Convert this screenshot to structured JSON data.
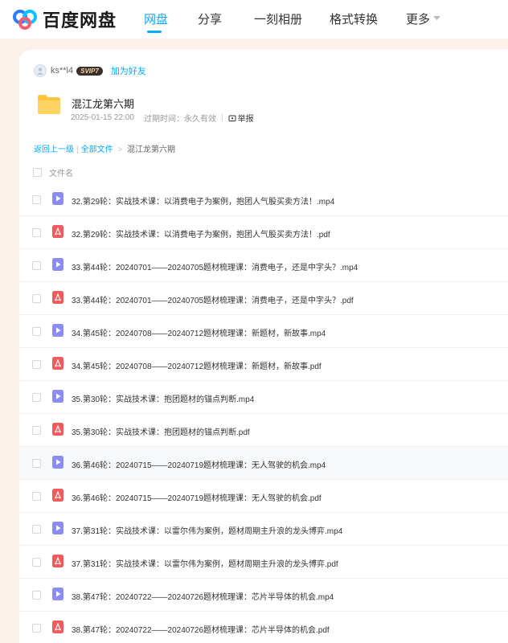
{
  "brand": {
    "name": "百度网盘"
  },
  "nav": {
    "items": [
      {
        "label": "网盘",
        "active": true
      },
      {
        "label": "分享",
        "active": false
      },
      {
        "label": "一刻相册",
        "active": false
      },
      {
        "label": "格式转换",
        "active": false
      },
      {
        "label": "更多",
        "active": false
      }
    ]
  },
  "share": {
    "sharer": "ks**l4",
    "badge": "SVIP7",
    "add_friend": "加为好友",
    "title": "混江龙第六期",
    "date": "2025-01-15 22:00",
    "expire_label": "过期时间：永久有效",
    "report": "举报"
  },
  "breadcrumb": {
    "back": "返回上一级",
    "all": "全部文件",
    "arrow": ">",
    "current": "混江龙第六期"
  },
  "table": {
    "col_name": "文件名",
    "files": [
      {
        "name": "32.第29轮：实战技术课：以消费电子为案例，抱团人气股买卖方法！.mp4",
        "type": "video"
      },
      {
        "name": "32.第29轮：实战技术课：以消费电子为案例，抱团人气股买卖方法！.pdf",
        "type": "pdf"
      },
      {
        "name": "33.第44轮：20240701——20240705题材梳理课：消费电子，还是中字头？.mp4",
        "type": "video"
      },
      {
        "name": "33.第44轮：20240701——20240705题材梳理课：消费电子，还是中字头？.pdf",
        "type": "pdf"
      },
      {
        "name": "34.第45轮：20240708——20240712题材梳理课：新题材，新故事.mp4",
        "type": "video"
      },
      {
        "name": "34.第45轮：20240708——20240712题材梳理课：新题材，新故事.pdf",
        "type": "pdf"
      },
      {
        "name": "35.第30轮：实战技术课：抱团题材的锚点判断.mp4",
        "type": "video"
      },
      {
        "name": "35.第30轮：实战技术课：抱团题材的锚点判断.pdf",
        "type": "pdf"
      },
      {
        "name": "36.第46轮：20240715——20240719题材梳理课：无人驾驶的机会.mp4",
        "type": "video",
        "hover": true
      },
      {
        "name": "36.第46轮：20240715——20240719题材梳理课：无人驾驶的机会.pdf",
        "type": "pdf"
      },
      {
        "name": "37.第31轮：实战技术课：以雷尔伟为案例，题材周期主升浪的龙头博弈.mp4",
        "type": "video"
      },
      {
        "name": "37.第31轮：实战技术课：以雷尔伟为案例，题材周期主升浪的龙头博弈.pdf",
        "type": "pdf"
      },
      {
        "name": "38.第47轮：20240722——20240726题材梳理课：芯片半导体的机会.mp4",
        "type": "video"
      },
      {
        "name": "38.第47轮：20240722——20240726题材梳理课：芯片半导体的机会.pdf",
        "type": "pdf"
      }
    ]
  },
  "colors": {
    "accent": "#06a7ff",
    "video_icon": "#8c8cf7",
    "pdf_icon": "#f25b5b",
    "folder": "#ffc53d"
  }
}
